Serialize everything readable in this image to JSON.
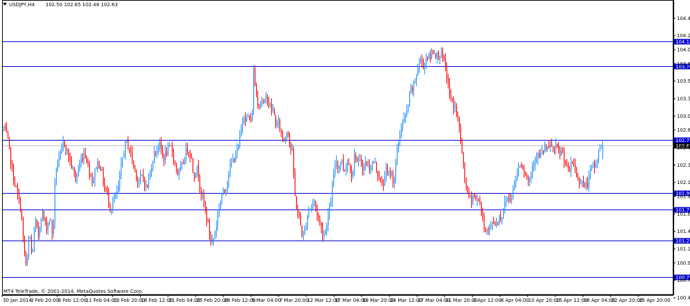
{
  "header": {
    "symbol_timeframe": "USDJPY,H4",
    "ohlc_text": "102.50 102.65 102.48 102.63"
  },
  "footer": {
    "copyright": "MT4 TeleTrade, © 2001-2014, MetaQuotes Software Corp."
  },
  "colors": {
    "background": "#ffffff",
    "frame": "#000000",
    "bull": "#1e90ff",
    "bear": "#ff0000",
    "level_line": "#0000cd",
    "level_label_bg": "#0000cd",
    "level_label_text": "#ffffff",
    "current_price_bg": "#000000",
    "current_price_line": "#c0c0c0"
  },
  "chart_data": {
    "type": "candlestick",
    "timeframe": "H4",
    "y_range": [
      100.49,
      104.7
    ],
    "y_ticks": [
      "104.45",
      "104.20",
      "104.00",
      "103.80",
      "103.55",
      "103.30",
      "103.05",
      "102.85",
      "102.60",
      "102.35",
      "102.10",
      "101.90",
      "101.65",
      "101.40",
      "101.15",
      "100.95",
      "100.70",
      "100.45"
    ],
    "x_ticks": [
      "30 Jan 2014",
      "3 Feb 20:00",
      "6 Feb 12:00",
      "11 Feb 04:00",
      "13 Feb 20:00",
      "18 Feb 12:00",
      "21 Feb 04:00",
      "25 Feb 20:00",
      "28 Feb 12:00",
      "5 Mar 04:00",
      "7 Mar 20:00",
      "12 Mar 12:00",
      "17 Mar 04:00",
      "19 Mar 20:00",
      "24 Mar 12:00",
      "27 Mar 04:00",
      "31 Mar 20:00",
      "3 Apr 12:00",
      "8 Apr 04:00",
      "10 Apr 20:00",
      "15 Apr 12:00",
      "18 Apr 04:00",
      "22 Apr 20:00",
      "25 Apr 20:00"
    ],
    "horizontal_levels": [
      "104.12",
      "103.76",
      "102.71",
      "101.95",
      "101.71",
      "101.27",
      "100.75"
    ],
    "current_price": "102.63",
    "last_candle": {
      "open": 102.5,
      "high": 102.65,
      "low": 102.48,
      "close": 102.63
    },
    "price_path": [
      [
        0,
        102.35
      ],
      [
        4,
        102.9
      ],
      [
        10,
        102.75
      ],
      [
        18,
        102.2
      ],
      [
        24,
        101.95
      ],
      [
        30,
        101.7
      ],
      [
        34,
        101.15
      ],
      [
        38,
        100.85
      ],
      [
        42,
        101.4
      ],
      [
        46,
        101.0
      ],
      [
        50,
        101.55
      ],
      [
        55,
        101.35
      ],
      [
        60,
        101.7
      ],
      [
        66,
        101.45
      ],
      [
        72,
        101.6
      ],
      [
        76,
        101.3
      ],
      [
        80,
        102.3
      ],
      [
        86,
        102.45
      ],
      [
        92,
        102.7
      ],
      [
        98,
        102.5
      ],
      [
        104,
        102.3
      ],
      [
        110,
        102.15
      ],
      [
        116,
        102.4
      ],
      [
        122,
        102.55
      ],
      [
        128,
        102.3
      ],
      [
        134,
        102.1
      ],
      [
        140,
        102.4
      ],
      [
        146,
        102.3
      ],
      [
        150,
        102.05
      ],
      [
        156,
        101.9
      ],
      [
        160,
        101.7
      ],
      [
        164,
        101.85
      ],
      [
        170,
        101.95
      ],
      [
        176,
        102.4
      ],
      [
        182,
        102.7
      ],
      [
        188,
        102.55
      ],
      [
        194,
        102.3
      ],
      [
        200,
        102.1
      ],
      [
        206,
        102.2
      ],
      [
        212,
        102.0
      ],
      [
        218,
        102.3
      ],
      [
        224,
        102.55
      ],
      [
        230,
        102.65
      ],
      [
        236,
        102.45
      ],
      [
        242,
        102.55
      ],
      [
        248,
        102.6
      ],
      [
        252,
        102.4
      ],
      [
        258,
        102.2
      ],
      [
        264,
        102.35
      ],
      [
        270,
        102.6
      ],
      [
        276,
        102.5
      ],
      [
        280,
        102.2
      ],
      [
        286,
        102.3
      ],
      [
        290,
        102.0
      ],
      [
        296,
        101.75
      ],
      [
        300,
        101.55
      ],
      [
        304,
        101.3
      ],
      [
        308,
        101.25
      ],
      [
        312,
        101.45
      ],
      [
        316,
        101.7
      ],
      [
        320,
        101.9
      ],
      [
        326,
        102.0
      ],
      [
        332,
        102.3
      ],
      [
        338,
        102.45
      ],
      [
        344,
        102.55
      ],
      [
        348,
        102.8
      ],
      [
        352,
        103.1
      ],
      [
        356,
        103.0
      ],
      [
        360,
        103.05
      ],
      [
        364,
        102.9
      ],
      [
        367,
        103.7
      ],
      [
        370,
        103.4
      ],
      [
        374,
        103.2
      ],
      [
        378,
        103.3
      ],
      [
        382,
        103.2
      ],
      [
        386,
        103.35
      ],
      [
        390,
        103.2
      ],
      [
        396,
        103.1
      ],
      [
        400,
        102.9
      ],
      [
        404,
        102.95
      ],
      [
        408,
        102.75
      ],
      [
        412,
        102.7
      ],
      [
        416,
        102.9
      ],
      [
        420,
        102.6
      ],
      [
        424,
        102.5
      ],
      [
        426,
        101.95
      ],
      [
        430,
        101.7
      ],
      [
        434,
        101.55
      ],
      [
        438,
        101.3
      ],
      [
        442,
        101.45
      ],
      [
        446,
        101.7
      ],
      [
        450,
        101.75
      ],
      [
        454,
        101.85
      ],
      [
        458,
        101.7
      ],
      [
        462,
        101.55
      ],
      [
        466,
        101.4
      ],
      [
        470,
        101.35
      ],
      [
        474,
        101.6
      ],
      [
        478,
        101.75
      ],
      [
        482,
        102.1
      ],
      [
        486,
        102.45
      ],
      [
        490,
        102.3
      ],
      [
        494,
        102.45
      ],
      [
        498,
        102.25
      ],
      [
        502,
        102.4
      ],
      [
        506,
        102.35
      ],
      [
        510,
        102.2
      ],
      [
        514,
        102.55
      ],
      [
        518,
        102.35
      ],
      [
        522,
        102.4
      ],
      [
        526,
        102.3
      ],
      [
        530,
        102.4
      ],
      [
        534,
        102.3
      ],
      [
        538,
        102.35
      ],
      [
        542,
        102.4
      ],
      [
        546,
        102.25
      ],
      [
        550,
        102.15
      ],
      [
        554,
        102.0
      ],
      [
        558,
        102.3
      ],
      [
        562,
        102.2
      ],
      [
        566,
        102.25
      ],
      [
        570,
        102.1
      ],
      [
        574,
        102.45
      ],
      [
        578,
        102.75
      ],
      [
        582,
        102.95
      ],
      [
        586,
        103.0
      ],
      [
        590,
        103.15
      ],
      [
        594,
        103.4
      ],
      [
        598,
        103.45
      ],
      [
        602,
        103.6
      ],
      [
        606,
        103.8
      ],
      [
        610,
        103.85
      ],
      [
        614,
        103.75
      ],
      [
        618,
        103.95
      ],
      [
        622,
        103.85
      ],
      [
        626,
        104.0
      ],
      [
        630,
        103.95
      ],
      [
        634,
        103.9
      ],
      [
        638,
        103.95
      ],
      [
        642,
        103.85
      ],
      [
        646,
        103.7
      ],
      [
        650,
        103.4
      ],
      [
        654,
        103.25
      ],
      [
        658,
        103.2
      ],
      [
        662,
        103.05
      ],
      [
        666,
        102.8
      ],
      [
        670,
        102.4
      ],
      [
        674,
        102.1
      ],
      [
        678,
        101.9
      ],
      [
        682,
        101.85
      ],
      [
        686,
        101.95
      ],
      [
        690,
        101.8
      ],
      [
        694,
        101.9
      ],
      [
        698,
        101.6
      ],
      [
        702,
        101.45
      ],
      [
        706,
        101.4
      ],
      [
        710,
        101.45
      ],
      [
        714,
        101.55
      ],
      [
        718,
        101.5
      ],
      [
        722,
        101.6
      ],
      [
        726,
        101.6
      ],
      [
        730,
        101.75
      ],
      [
        734,
        101.9
      ],
      [
        738,
        101.85
      ],
      [
        742,
        101.95
      ],
      [
        746,
        102.15
      ],
      [
        750,
        102.3
      ],
      [
        754,
        102.4
      ],
      [
        758,
        102.3
      ],
      [
        762,
        102.2
      ],
      [
        766,
        102.1
      ],
      [
        770,
        102.3
      ],
      [
        774,
        102.45
      ],
      [
        778,
        102.5
      ],
      [
        782,
        102.45
      ],
      [
        786,
        102.55
      ],
      [
        790,
        102.6
      ],
      [
        794,
        102.55
      ],
      [
        798,
        102.65
      ],
      [
        802,
        102.55
      ],
      [
        806,
        102.6
      ],
      [
        810,
        102.5
      ],
      [
        814,
        102.55
      ],
      [
        818,
        102.4
      ],
      [
        822,
        102.25
      ],
      [
        826,
        102.3
      ],
      [
        830,
        102.4
      ],
      [
        834,
        102.25
      ],
      [
        838,
        102.1
      ],
      [
        842,
        102.15
      ],
      [
        846,
        102.05
      ],
      [
        850,
        102.05
      ],
      [
        854,
        102.2
      ],
      [
        858,
        102.35
      ],
      [
        862,
        102.3
      ],
      [
        866,
        102.5
      ],
      [
        870,
        102.6
      ],
      [
        873,
        102.63
      ]
    ]
  }
}
